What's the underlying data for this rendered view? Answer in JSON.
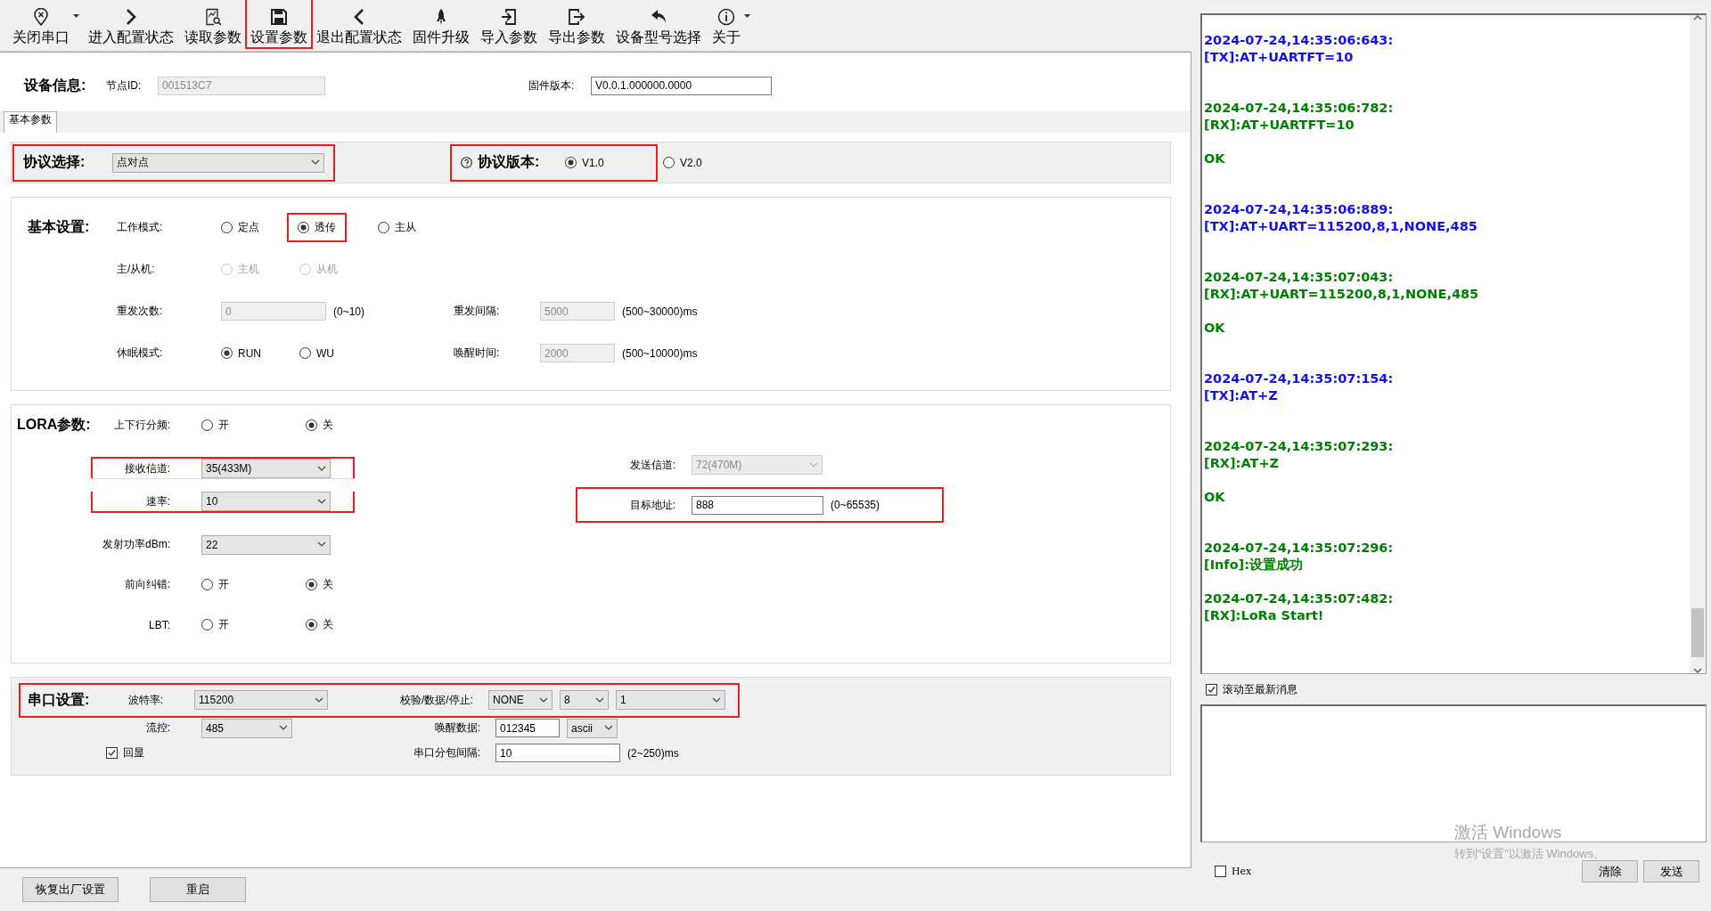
{
  "toolbar": [
    {
      "label": "关闭串口",
      "has_menu": true,
      "highlighted": false
    },
    {
      "label": "进入配置状态",
      "has_menu": false,
      "highlighted": false
    },
    {
      "label": "读取参数",
      "has_menu": false,
      "highlighted": false
    },
    {
      "label": "设置参数",
      "has_menu": false,
      "highlighted": true
    },
    {
      "label": "退出配置状态",
      "has_menu": false,
      "highlighted": false
    },
    {
      "label": "固件升级",
      "has_menu": false,
      "highlighted": false
    },
    {
      "label": "导入参数",
      "has_menu": false,
      "highlighted": false
    },
    {
      "label": "导出参数",
      "has_menu": false,
      "highlighted": false
    },
    {
      "label": "设备型号选择",
      "has_menu": false,
      "highlighted": false
    },
    {
      "label": "关于",
      "has_menu": true,
      "highlighted": false
    }
  ],
  "device_info": {
    "title": "设备信息:",
    "node_id_label": "节点ID:",
    "node_id": {
      "value": "001513C7",
      "disabled": true
    },
    "firmware_label": "固件版本:",
    "firmware": {
      "value": "V0.0.1.000000.0000",
      "disabled": false
    }
  },
  "tabs": [
    {
      "label": "基本参数",
      "selected": true
    }
  ],
  "protocol": {
    "label": "协议选择:",
    "value": "点对点",
    "highlighted": true,
    "version_label": "协议版本:",
    "versions": [
      {
        "label": "V1.0",
        "selected": true,
        "highlighted": true
      },
      {
        "label": "V2.0",
        "selected": false,
        "highlighted": false
      }
    ]
  },
  "basic_settings": {
    "title": "基本设置:",
    "rows": [
      {
        "label": "工作模式:",
        "controls": [
          {
            "kind": "radio",
            "label": "定点",
            "selected": false,
            "highlighted": false
          },
          {
            "kind": "radio",
            "label": "透传",
            "selected": true,
            "highlighted": true
          },
          {
            "kind": "radio",
            "label": "主从",
            "selected": false,
            "highlighted": false
          }
        ]
      },
      {
        "label": "主/从机:",
        "disabled": true,
        "controls": [
          {
            "kind": "radio",
            "label": "主机",
            "selected": false
          },
          {
            "kind": "radio",
            "label": "从机",
            "selected": false
          }
        ]
      },
      {
        "label": "重发次数:",
        "controls": [
          {
            "kind": "input",
            "value": "0",
            "disabled": true
          }
        ],
        "hint": "(0~10)",
        "right": {
          "label": "重发间隔:",
          "controls": [
            {
              "kind": "input",
              "value": "5000",
              "disabled": true
            }
          ],
          "hint": "(500~30000)ms",
          "highlighted": false
        }
      },
      {
        "label": "休眠模式:",
        "controls": [
          {
            "kind": "radio",
            "label": "RUN",
            "selected": true
          },
          {
            "kind": "radio",
            "label": "WU",
            "selected": false
          }
        ],
        "right": {
          "label": "唤醒时间:",
          "controls": [
            {
              "kind": "input",
              "value": "2000",
              "disabled": true
            }
          ],
          "hint": "(500~10000)ms",
          "highlighted": false
        }
      }
    ]
  },
  "lora_params": {
    "title": "LORA参数:",
    "rows": [
      {
        "label": "上下行分频:",
        "highlighted": false,
        "controls": [
          {
            "kind": "radio",
            "label": "开",
            "selected": false
          },
          {
            "kind": "radio",
            "label": "关",
            "selected": true
          }
        ]
      },
      {
        "label": "接收信道:",
        "highlighted": true,
        "controls": [
          {
            "kind": "select",
            "value": "35(433M)",
            "disabled": false
          }
        ],
        "right": {
          "label": "发送信道:",
          "controls": [
            {
              "kind": "select",
              "value": "72(470M)",
              "disabled": true
            }
          ],
          "highlighted": false
        }
      },
      {
        "label": "速率:",
        "highlighted": true,
        "controls": [
          {
            "kind": "select",
            "value": "10",
            "disabled": false
          }
        ],
        "right": {
          "label": "目标地址:",
          "controls": [
            {
              "kind": "input",
              "value": "888",
              "disabled": false
            }
          ],
          "hint": "(0~65535)",
          "highlighted": true
        }
      },
      {
        "label": "发射功率dBm:",
        "highlighted": false,
        "controls": [
          {
            "kind": "select",
            "value": "22",
            "disabled": false
          }
        ]
      },
      {
        "label": "前向纠错:",
        "highlighted": false,
        "controls": [
          {
            "kind": "radio",
            "label": "开",
            "selected": false
          },
          {
            "kind": "radio",
            "label": "关",
            "selected": true
          }
        ]
      },
      {
        "label": "LBT:",
        "highlighted": false,
        "controls": [
          {
            "kind": "radio",
            "label": "开",
            "selected": false
          },
          {
            "kind": "radio",
            "label": "关",
            "selected": true
          }
        ]
      }
    ]
  },
  "serial_settings": {
    "title": "串口设置:",
    "rows": [
      {
        "label": "波特率:",
        "highlighted": true,
        "controls": [
          {
            "kind": "select",
            "value": "115200",
            "disabled": false
          }
        ],
        "right": {
          "label": "校验/数据/停止:",
          "controls": [
            {
              "kind": "select",
              "value": "NONE",
              "disabled": false
            },
            {
              "kind": "select",
              "value": "8",
              "disabled": false
            },
            {
              "kind": "select",
              "value": "1",
              "disabled": false
            }
          ],
          "highlighted": false
        }
      },
      {
        "label": "流控:",
        "highlighted": false,
        "controls": [
          {
            "kind": "select",
            "value": "485",
            "disabled": false
          }
        ],
        "right": {
          "label": "唤醒数据:",
          "controls": [
            {
              "kind": "input",
              "value": "012345",
              "disabled": false
            },
            {
              "kind": "select",
              "value": "ascii",
              "disabled": false
            }
          ],
          "highlighted": false
        }
      },
      {
        "highlighted": false,
        "controls": [
          {
            "kind": "checkbox",
            "label": "回显",
            "checked": true
          }
        ],
        "right": {
          "label": "串口分包间隔:",
          "controls": [
            {
              "kind": "input",
              "value": "10",
              "disabled": false
            }
          ],
          "hint": "(2~250)ms",
          "highlighted": false
        }
      }
    ]
  },
  "footer_buttons": [
    "恢复出厂设置",
    "重启"
  ],
  "log": [
    {
      "kind": "tx",
      "time": "2024-07-24,14:35:06:643:",
      "message": "[TX]:AT+UARTFT=10"
    },
    {
      "kind": "rx",
      "time": "2024-07-24,14:35:06:782:",
      "message": "[RX]:AT+UARTFT=10",
      "reply": "OK"
    },
    {
      "kind": "tx",
      "time": "2024-07-24,14:35:06:889:",
      "message": "[TX]:AT+UART=115200,8,1,NONE,485"
    },
    {
      "kind": "rx",
      "time": "2024-07-24,14:35:07:043:",
      "message": "[RX]:AT+UART=115200,8,1,NONE,485",
      "reply": "OK"
    },
    {
      "kind": "tx",
      "time": "2024-07-24,14:35:07:154:",
      "message": "[TX]:AT+Z"
    },
    {
      "kind": "rx",
      "time": "2024-07-24,14:35:07:293:",
      "message": "[RX]:AT+Z",
      "reply": "OK"
    },
    {
      "kind": "info",
      "time": "2024-07-24,14:35:07:296:",
      "message": "[Info]:设置成功"
    },
    {
      "kind": "rx",
      "time": "2024-07-24,14:35:07:482:",
      "message": "[RX]:LoRa Start!"
    }
  ],
  "scroll_to_latest": {
    "label": "滚动至最新消息",
    "checked": true
  },
  "hex": {
    "label": "Hex",
    "checked": false
  },
  "console_buttons": [
    "清除",
    "发送"
  ],
  "activation_notice": {
    "title": "激活 Windows",
    "subtitle": "转到“设置”以激活 Windows。"
  }
}
